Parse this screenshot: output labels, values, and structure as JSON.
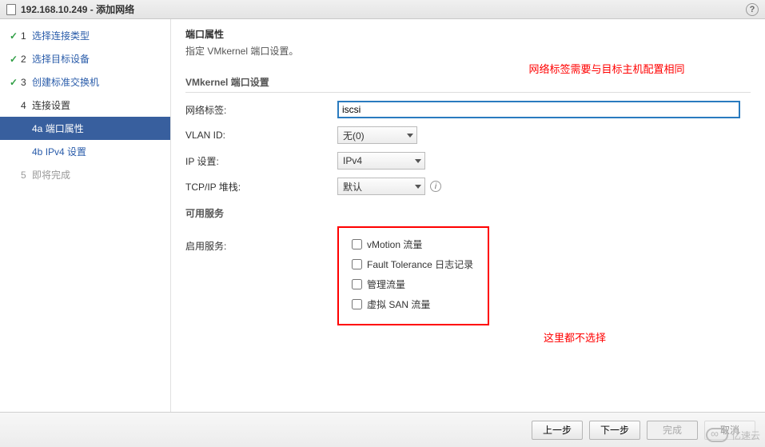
{
  "title": "192.168.10.249 - 添加网络",
  "sidebar": {
    "s1": "选择连接类型",
    "s2": "选择目标设备",
    "s3": "创建标准交换机",
    "s4": "连接设置",
    "s4a": "端口属性",
    "s4b": "IPv4 设置",
    "s5": "即将完成"
  },
  "main": {
    "heading": "端口属性",
    "desc": "指定 VMkernel 端口设置。",
    "annot1": "网络标签需要与目标主机配置相同",
    "section1": "VMkernel 端口设置",
    "labels": {
      "netlabel": "网络标签:",
      "vlan": "VLAN ID:",
      "ip": "IP 设置:",
      "tcpip": "TCP/IP 堆栈:",
      "available": "可用服务",
      "enable": "启用服务:"
    },
    "values": {
      "netlabel": "iscsi",
      "vlan": "无(0)",
      "ip": "IPv4",
      "tcpip": "默认"
    },
    "services": {
      "vmotion": "vMotion 流量",
      "ft": "Fault Tolerance 日志记录",
      "mgmt": "管理流量",
      "vsan": "虚拟 SAN 流量"
    },
    "annot2": "这里都不选择"
  },
  "footer": {
    "prev": "上一步",
    "next": "下一步",
    "finish": "完成",
    "cancel": "取消"
  },
  "watermark": "亿速云"
}
